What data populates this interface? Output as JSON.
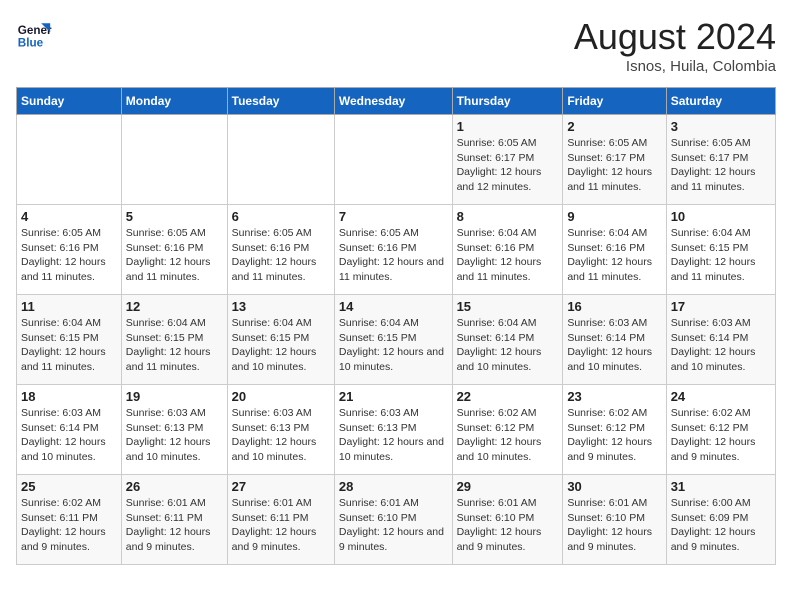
{
  "header": {
    "logo_line1": "General",
    "logo_line2": "Blue",
    "main_title": "August 2024",
    "subtitle": "Isnos, Huila, Colombia"
  },
  "weekdays": [
    "Sunday",
    "Monday",
    "Tuesday",
    "Wednesday",
    "Thursday",
    "Friday",
    "Saturday"
  ],
  "weeks": [
    [
      {
        "day": "",
        "sunrise": "",
        "sunset": "",
        "daylight": ""
      },
      {
        "day": "",
        "sunrise": "",
        "sunset": "",
        "daylight": ""
      },
      {
        "day": "",
        "sunrise": "",
        "sunset": "",
        "daylight": ""
      },
      {
        "day": "",
        "sunrise": "",
        "sunset": "",
        "daylight": ""
      },
      {
        "day": "1",
        "sunrise": "Sunrise: 6:05 AM",
        "sunset": "Sunset: 6:17 PM",
        "daylight": "Daylight: 12 hours and 12 minutes."
      },
      {
        "day": "2",
        "sunrise": "Sunrise: 6:05 AM",
        "sunset": "Sunset: 6:17 PM",
        "daylight": "Daylight: 12 hours and 11 minutes."
      },
      {
        "day": "3",
        "sunrise": "Sunrise: 6:05 AM",
        "sunset": "Sunset: 6:17 PM",
        "daylight": "Daylight: 12 hours and 11 minutes."
      }
    ],
    [
      {
        "day": "4",
        "sunrise": "Sunrise: 6:05 AM",
        "sunset": "Sunset: 6:16 PM",
        "daylight": "Daylight: 12 hours and 11 minutes."
      },
      {
        "day": "5",
        "sunrise": "Sunrise: 6:05 AM",
        "sunset": "Sunset: 6:16 PM",
        "daylight": "Daylight: 12 hours and 11 minutes."
      },
      {
        "day": "6",
        "sunrise": "Sunrise: 6:05 AM",
        "sunset": "Sunset: 6:16 PM",
        "daylight": "Daylight: 12 hours and 11 minutes."
      },
      {
        "day": "7",
        "sunrise": "Sunrise: 6:05 AM",
        "sunset": "Sunset: 6:16 PM",
        "daylight": "Daylight: 12 hours and 11 minutes."
      },
      {
        "day": "8",
        "sunrise": "Sunrise: 6:04 AM",
        "sunset": "Sunset: 6:16 PM",
        "daylight": "Daylight: 12 hours and 11 minutes."
      },
      {
        "day": "9",
        "sunrise": "Sunrise: 6:04 AM",
        "sunset": "Sunset: 6:16 PM",
        "daylight": "Daylight: 12 hours and 11 minutes."
      },
      {
        "day": "10",
        "sunrise": "Sunrise: 6:04 AM",
        "sunset": "Sunset: 6:15 PM",
        "daylight": "Daylight: 12 hours and 11 minutes."
      }
    ],
    [
      {
        "day": "11",
        "sunrise": "Sunrise: 6:04 AM",
        "sunset": "Sunset: 6:15 PM",
        "daylight": "Daylight: 12 hours and 11 minutes."
      },
      {
        "day": "12",
        "sunrise": "Sunrise: 6:04 AM",
        "sunset": "Sunset: 6:15 PM",
        "daylight": "Daylight: 12 hours and 11 minutes."
      },
      {
        "day": "13",
        "sunrise": "Sunrise: 6:04 AM",
        "sunset": "Sunset: 6:15 PM",
        "daylight": "Daylight: 12 hours and 10 minutes."
      },
      {
        "day": "14",
        "sunrise": "Sunrise: 6:04 AM",
        "sunset": "Sunset: 6:15 PM",
        "daylight": "Daylight: 12 hours and 10 minutes."
      },
      {
        "day": "15",
        "sunrise": "Sunrise: 6:04 AM",
        "sunset": "Sunset: 6:14 PM",
        "daylight": "Daylight: 12 hours and 10 minutes."
      },
      {
        "day": "16",
        "sunrise": "Sunrise: 6:03 AM",
        "sunset": "Sunset: 6:14 PM",
        "daylight": "Daylight: 12 hours and 10 minutes."
      },
      {
        "day": "17",
        "sunrise": "Sunrise: 6:03 AM",
        "sunset": "Sunset: 6:14 PM",
        "daylight": "Daylight: 12 hours and 10 minutes."
      }
    ],
    [
      {
        "day": "18",
        "sunrise": "Sunrise: 6:03 AM",
        "sunset": "Sunset: 6:14 PM",
        "daylight": "Daylight: 12 hours and 10 minutes."
      },
      {
        "day": "19",
        "sunrise": "Sunrise: 6:03 AM",
        "sunset": "Sunset: 6:13 PM",
        "daylight": "Daylight: 12 hours and 10 minutes."
      },
      {
        "day": "20",
        "sunrise": "Sunrise: 6:03 AM",
        "sunset": "Sunset: 6:13 PM",
        "daylight": "Daylight: 12 hours and 10 minutes."
      },
      {
        "day": "21",
        "sunrise": "Sunrise: 6:03 AM",
        "sunset": "Sunset: 6:13 PM",
        "daylight": "Daylight: 12 hours and 10 minutes."
      },
      {
        "day": "22",
        "sunrise": "Sunrise: 6:02 AM",
        "sunset": "Sunset: 6:12 PM",
        "daylight": "Daylight: 12 hours and 10 minutes."
      },
      {
        "day": "23",
        "sunrise": "Sunrise: 6:02 AM",
        "sunset": "Sunset: 6:12 PM",
        "daylight": "Daylight: 12 hours and 9 minutes."
      },
      {
        "day": "24",
        "sunrise": "Sunrise: 6:02 AM",
        "sunset": "Sunset: 6:12 PM",
        "daylight": "Daylight: 12 hours and 9 minutes."
      }
    ],
    [
      {
        "day": "25",
        "sunrise": "Sunrise: 6:02 AM",
        "sunset": "Sunset: 6:11 PM",
        "daylight": "Daylight: 12 hours and 9 minutes."
      },
      {
        "day": "26",
        "sunrise": "Sunrise: 6:01 AM",
        "sunset": "Sunset: 6:11 PM",
        "daylight": "Daylight: 12 hours and 9 minutes."
      },
      {
        "day": "27",
        "sunrise": "Sunrise: 6:01 AM",
        "sunset": "Sunset: 6:11 PM",
        "daylight": "Daylight: 12 hours and 9 minutes."
      },
      {
        "day": "28",
        "sunrise": "Sunrise: 6:01 AM",
        "sunset": "Sunset: 6:10 PM",
        "daylight": "Daylight: 12 hours and 9 minutes."
      },
      {
        "day": "29",
        "sunrise": "Sunrise: 6:01 AM",
        "sunset": "Sunset: 6:10 PM",
        "daylight": "Daylight: 12 hours and 9 minutes."
      },
      {
        "day": "30",
        "sunrise": "Sunrise: 6:01 AM",
        "sunset": "Sunset: 6:10 PM",
        "daylight": "Daylight: 12 hours and 9 minutes."
      },
      {
        "day": "31",
        "sunrise": "Sunrise: 6:00 AM",
        "sunset": "Sunset: 6:09 PM",
        "daylight": "Daylight: 12 hours and 9 minutes."
      }
    ]
  ]
}
